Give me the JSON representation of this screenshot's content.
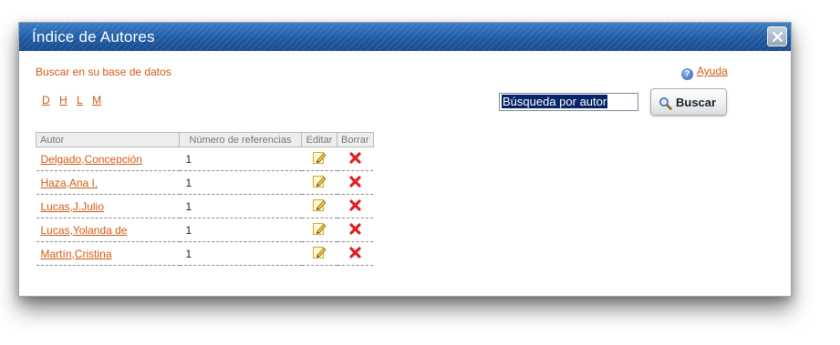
{
  "dialog": {
    "title": "Índice de Autores"
  },
  "search": {
    "hint": "Buscar en su base de datos",
    "letters": [
      "D",
      "H",
      "L",
      "M"
    ],
    "help_label": "Ayuda",
    "input_value": "Búsqueda por autor",
    "button_label": "Buscar"
  },
  "table": {
    "headers": {
      "author": "Autor",
      "references": "Número de referencias",
      "edit": "Editar",
      "delete": "Borrar"
    },
    "rows": [
      {
        "name": "Delgado,Concepción",
        "count": "1"
      },
      {
        "name": "Haza,Ana I.",
        "count": "1"
      },
      {
        "name": "Lucas,J.Julio",
        "count": "1"
      },
      {
        "name": "Lucas,Yolanda de",
        "count": "1"
      },
      {
        "name": "Martín,Cristina",
        "count": "1"
      }
    ]
  },
  "icons": {
    "close": "close-icon",
    "help": "help-icon",
    "search": "magnifier-icon",
    "edit": "pencil-icon",
    "delete": "red-x-icon"
  },
  "colors": {
    "titlebar": "#1f5fa8",
    "link": "#d05a12",
    "delete": "#e02020",
    "selection": "#0a246a"
  }
}
